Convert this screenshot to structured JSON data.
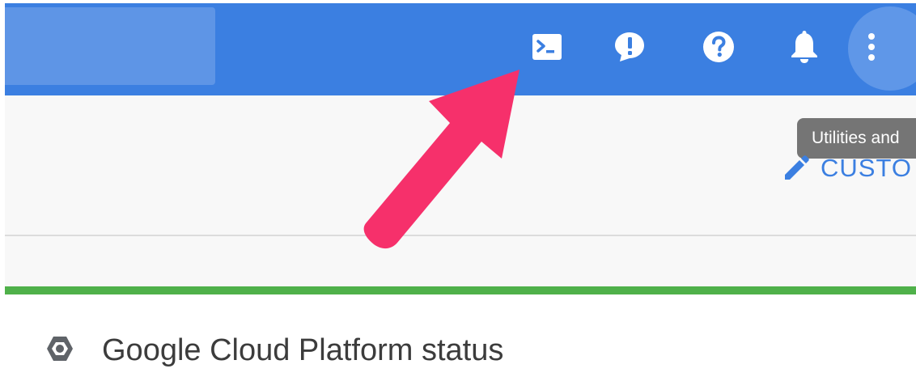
{
  "topbar": {
    "icons": [
      {
        "name": "cloud-shell-icon",
        "label": "Activate Cloud Shell"
      },
      {
        "name": "feedback-icon",
        "label": "Send feedback"
      },
      {
        "name": "help-icon",
        "label": "Help"
      },
      {
        "name": "notifications-icon",
        "label": "Notifications"
      },
      {
        "name": "more-vert-icon",
        "label": "More"
      }
    ],
    "accent_color": "#3b7fe1"
  },
  "tooltip": {
    "text": "Utilities and"
  },
  "customize": {
    "label": "CUSTO"
  },
  "status": {
    "title": "Google Cloud Platform status",
    "bar_color": "#4fb14a"
  },
  "annotation": {
    "color": "#f6306b"
  }
}
